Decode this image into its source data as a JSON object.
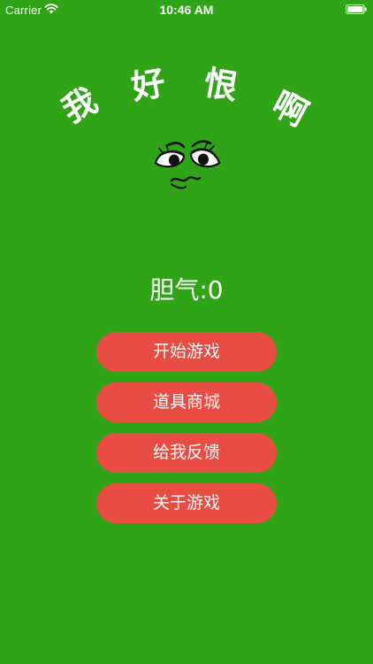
{
  "status_bar": {
    "carrier": "Carrier",
    "time": "10:46 AM",
    "wifi_icon": "wifi-icon",
    "battery_icon": "battery-icon"
  },
  "title": {
    "chars": [
      "我",
      "好",
      "恨",
      "啊"
    ]
  },
  "mascot_icon": "worried-face-icon",
  "courage": {
    "text": "胆气:0"
  },
  "menu": {
    "start_label": "开始游戏",
    "store_label": "道具商城",
    "feedback_label": "给我反馈",
    "about_label": "关于游戏"
  },
  "colors": {
    "background": "#2fa416",
    "button": "#e84c43",
    "text": "#ffffff"
  }
}
